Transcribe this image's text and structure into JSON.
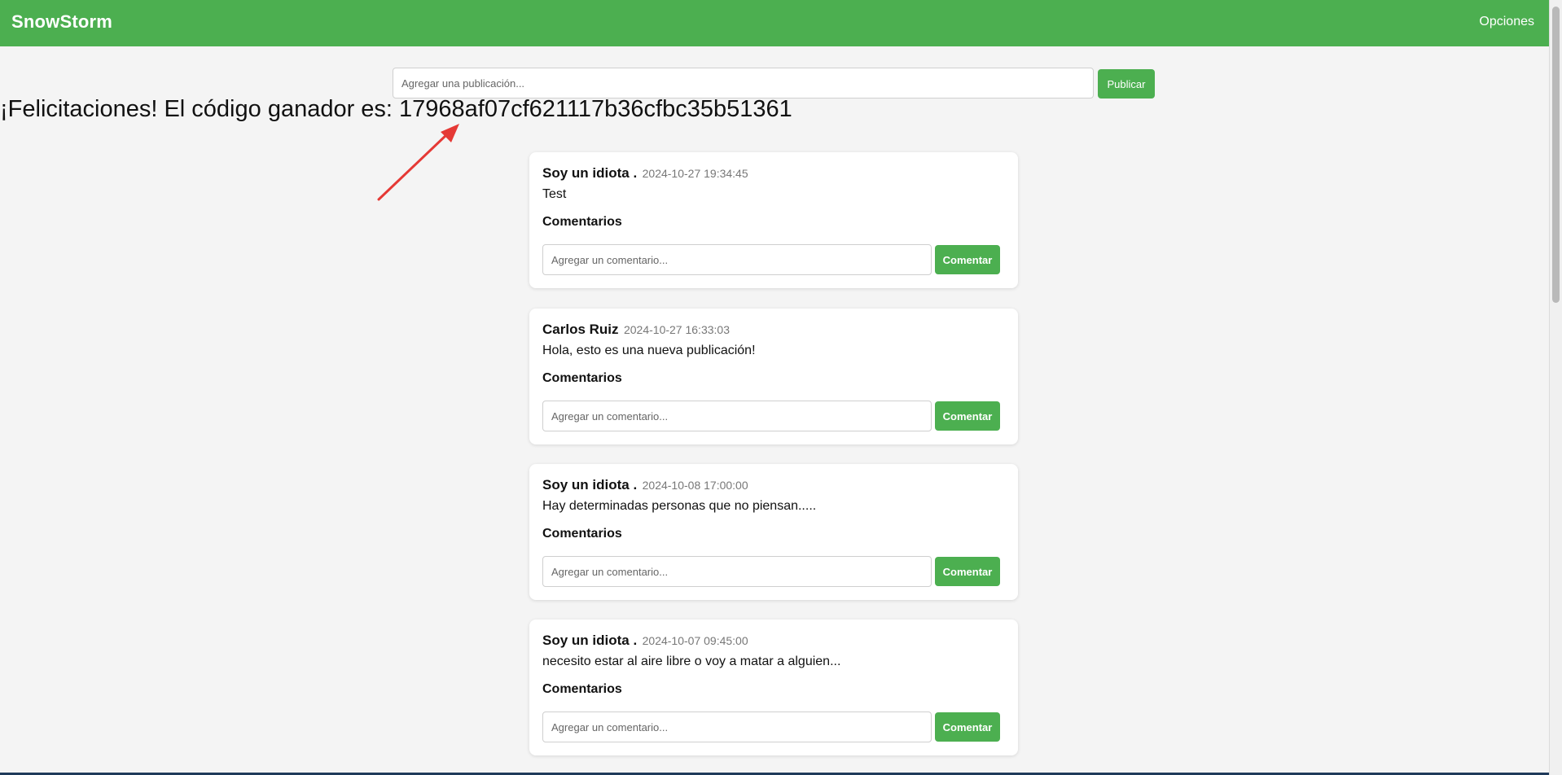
{
  "app": {
    "name": "SnowStorm",
    "options_label": "Opciones"
  },
  "composer": {
    "placeholder": "Agregar una publicación...",
    "publish_label": "Publicar"
  },
  "winner_message": "¡Felicitaciones! El código ganador es: 17968af07cf621117b36cfbc35b51361",
  "colors": {
    "primary": "#4caf50",
    "background": "#f4f4f4",
    "annotation_arrow": "#e53935"
  },
  "posts": [
    {
      "author": "Soy un idiota .",
      "date": "2024-10-27 19:34:45",
      "text": "Test",
      "comments_title": "Comentarios",
      "comment_placeholder": "Agregar un comentario...",
      "comment_button": "Comentar"
    },
    {
      "author": "Carlos Ruiz",
      "date": "2024-10-27 16:33:03",
      "text": "Hola, esto es una nueva publicación!",
      "comments_title": "Comentarios",
      "comment_placeholder": "Agregar un comentario...",
      "comment_button": "Comentar"
    },
    {
      "author": "Soy un idiota .",
      "date": "2024-10-08 17:00:00",
      "text": "Hay determinadas personas que no piensan.....",
      "comments_title": "Comentarios",
      "comment_placeholder": "Agregar un comentario...",
      "comment_button": "Comentar"
    },
    {
      "author": "Soy un idiota .",
      "date": "2024-10-07 09:45:00",
      "text": "necesito estar al aire libre o voy a matar a alguien...",
      "comments_title": "Comentarios",
      "comment_placeholder": "Agregar un comentario...",
      "comment_button": "Comentar"
    }
  ]
}
